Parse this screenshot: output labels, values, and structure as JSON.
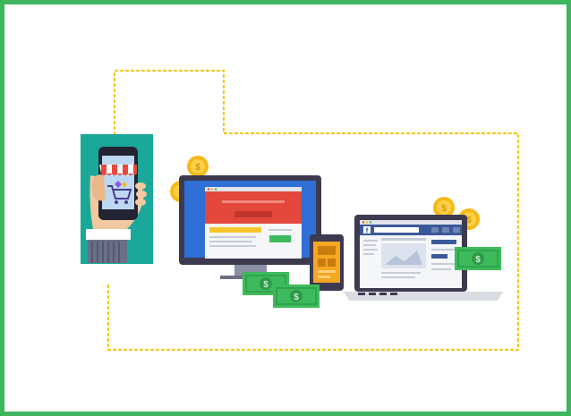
{
  "frame": {
    "border_color": "#3cb55e",
    "background": "#ffffff"
  },
  "illustration": {
    "path_color": "#f5c518",
    "icons": [
      "mobile-shopping-icon",
      "desktop-monitor-icon",
      "tablet-icon",
      "laptop-icon",
      "coin-icon",
      "banknote-icon"
    ],
    "colors": {
      "teal_panel": "#1aa89a",
      "store_awning_red": "#e8483a",
      "monitor_frame": "#3d3a4f",
      "screen_blue": "#2f6fd6",
      "web_red": "#e4473b",
      "coin_gold": "#f7b916",
      "money_green": "#3dbb5c",
      "tablet_orange": "#f5a623",
      "facebook_blue": "#3b5998"
    }
  }
}
